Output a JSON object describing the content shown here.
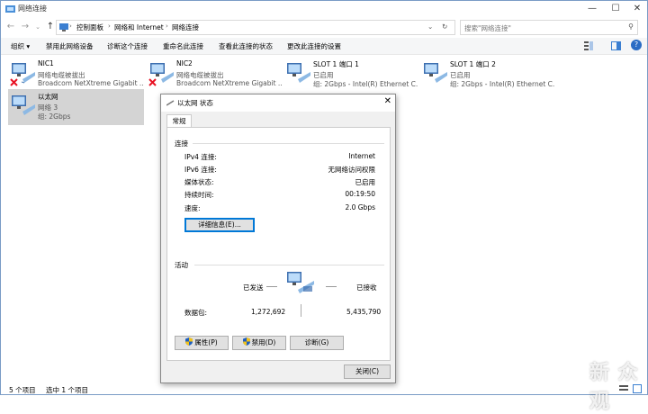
{
  "window": {
    "title": "网络连接"
  },
  "address": {
    "crumbs": [
      "控制面板",
      "网络和 Internet",
      "网络连接"
    ],
    "search_placeholder": "搜索\"网络连接\""
  },
  "toolbar": {
    "organize": "组织 ▾",
    "disable": "禁用此网络设备",
    "diagnose": "诊断这个连接",
    "rename": "重命名此连接",
    "view_status": "查看此连接的状态",
    "change_settings": "更改此连接的设置"
  },
  "connections": [
    {
      "name": "NIC1",
      "status": "网络电缆被拔出",
      "device": "Broadcom NetXtreme Gigabit ...",
      "error": true
    },
    {
      "name": "NIC2",
      "status": "网络电缆被拔出",
      "device": "Broadcom NetXtreme Gigabit ...",
      "error": true
    },
    {
      "name": "SLOT 1 端口 1",
      "status": "已启用",
      "device": "组: 2Gbps - Intel(R) Ethernet C...",
      "error": false
    },
    {
      "name": "SLOT 1 端口 2",
      "status": "已启用",
      "device": "组: 2Gbps - Intel(R) Ethernet C...",
      "error": false
    },
    {
      "name": "以太网",
      "status": "网络 3",
      "device": "组: 2Gbps",
      "error": false
    }
  ],
  "statusbar": {
    "count": "5 个项目",
    "selected": "选中 1 个项目"
  },
  "dialog": {
    "title": "以太网 状态",
    "tab": "常规",
    "connection_group": "连接",
    "rows": [
      {
        "label": "IPv4 连接:",
        "value": "Internet"
      },
      {
        "label": "IPv6 连接:",
        "value": "无网络访问权限"
      },
      {
        "label": "媒体状态:",
        "value": "已启用"
      },
      {
        "label": "持续时间:",
        "value": "00:19:50"
      },
      {
        "label": "速度:",
        "value": "2.0 Gbps"
      }
    ],
    "details_button": "详细信息(E)...",
    "activity_group": "活动",
    "sent_label": "已发送",
    "received_label": "已接收",
    "packets_label": "数据包:",
    "packets_sent": "1,272,692",
    "packets_received": "5,435,790",
    "properties_button": "属性(P)",
    "disable_button": "禁用(D)",
    "diagnose_button": "诊断(G)",
    "close_button": "关闭(C)"
  },
  "watermark": "新 众观",
  "colors": {
    "accent": "#0078d7",
    "error": "#e81123",
    "selected": "#d4d4d4"
  }
}
